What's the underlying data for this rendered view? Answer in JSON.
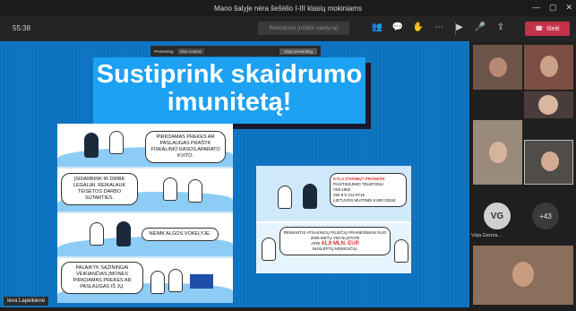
{
  "window": {
    "title": "Mano šalyje nėra šešėlio I-III klasių mokiniams",
    "minimize": "—",
    "maximize": "▢",
    "close": "✕"
  },
  "toolbar": {
    "timer": "55:38",
    "center_button": "Rekoduoti (uždėti vaidyną)",
    "leave_label": "Išeiti",
    "icons": [
      "people-icon",
      "chat-icon",
      "raise-hand-icon",
      "more-icon",
      "camera-icon",
      "mic-off-icon",
      "share-icon"
    ]
  },
  "presenting_bar": {
    "label": "Presenting",
    "control": "Give control",
    "stop": "Stop presenting"
  },
  "slide": {
    "title": "Sustiprink skaidrumo imunitetą!",
    "panels": [
      "PIRKDAMAS PREKES AR PASLAUGAS PRAŠYK FISKALINIO KASOS APARATO KVITO.",
      "ĮSIDARBINK IR DIRBK LEGALIAI. REIKALAUK TEISĖTOS DARBO SUTARTIES.",
      "NEIMK ALGOS VOKELYJE.",
      "PALAIKYK SĄŽININGAI VEIKIANČIAS ĮMONES PIRKDAMAS PREKES AR PASLAUGAS IŠ JŲ."
    ],
    "right_top": {
      "heading": "KYLA ĮTARIMŲ? PRANEŠK",
      "line1": "PASITIKĖJIMO TELEFONU",
      "line2": "VMI 1882",
      "line3": "VDI 8 5 213 9716",
      "line4": "LIETUVOS MUITINEI 8 800 33344"
    },
    "right_bottom": {
      "text1": "REMIANTIS ATSAKINGŲ PILIEČIŲ PRANEŠIMAIS NUO 2006 METŲ VMI NUSTATĖ",
      "amount_prefix": "APIE",
      "amount": "41,9 MLN. EUR",
      "text2": "NUSLĖPTŲ MOKESČIŲ."
    }
  },
  "presenter_name": "Ieva Lapeikienė",
  "gallery": {
    "avatar_initials": "VG",
    "avatar_name": "Vėja Germa...",
    "more_count": "+43"
  }
}
